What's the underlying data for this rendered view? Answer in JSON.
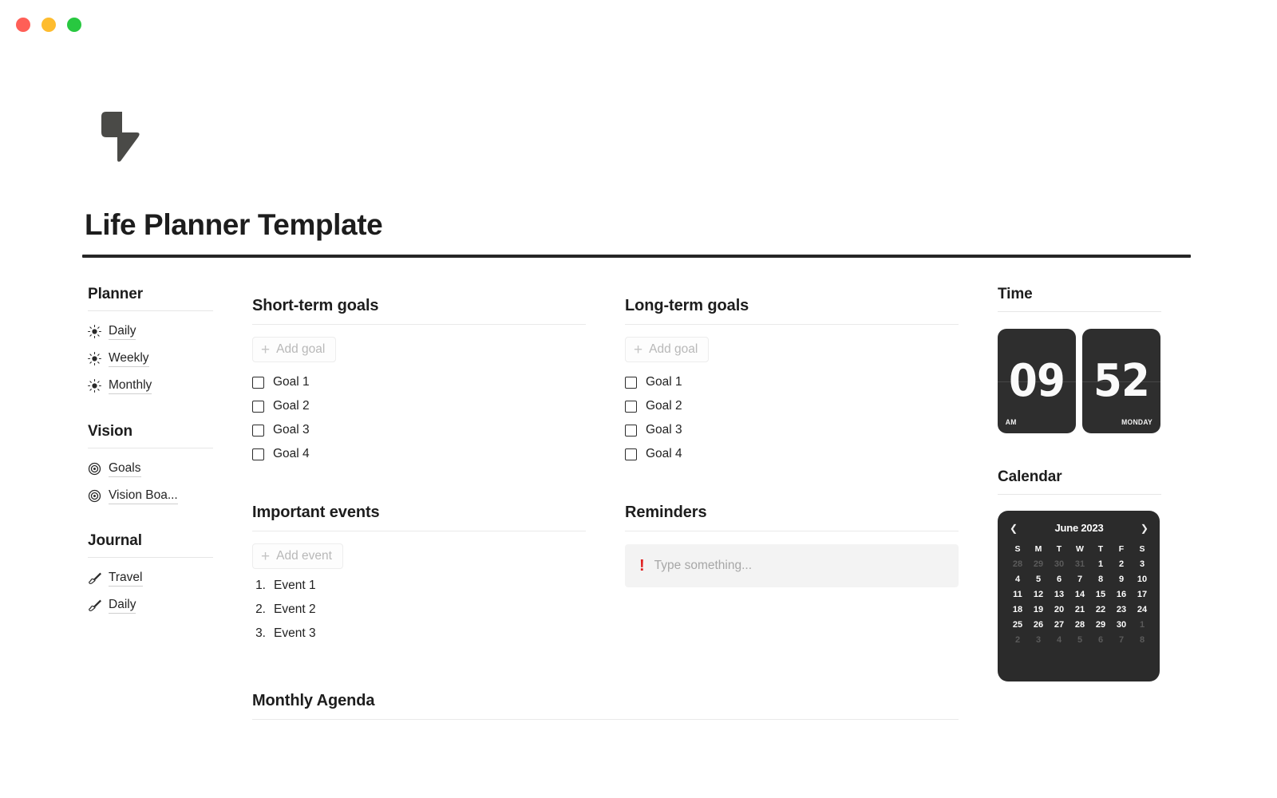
{
  "window": {
    "lights": [
      "close",
      "minimize",
      "maximize"
    ]
  },
  "header": {
    "logo_icon": "lightning-bolt-icon",
    "title": "Life Planner Template"
  },
  "sidebar": {
    "groups": [
      {
        "heading": "Planner",
        "items": [
          {
            "icon": "sun-icon",
            "label": "Daily"
          },
          {
            "icon": "sun-icon",
            "label": "Weekly"
          },
          {
            "icon": "sun-icon",
            "label": "Monthly"
          }
        ]
      },
      {
        "heading": "Vision",
        "items": [
          {
            "icon": "target-icon",
            "label": "Goals"
          },
          {
            "icon": "target-icon",
            "label": "Vision Boa..."
          }
        ]
      },
      {
        "heading": "Journal",
        "items": [
          {
            "icon": "paintbrush-icon",
            "label": "Travel"
          },
          {
            "icon": "paintbrush-icon",
            "label": "Daily"
          }
        ]
      }
    ]
  },
  "short_term_goals": {
    "title": "Short-term goals",
    "add_label": "Add goal",
    "items": [
      "Goal 1",
      "Goal 2",
      "Goal 3",
      "Goal 4"
    ]
  },
  "long_term_goals": {
    "title": "Long-term goals",
    "add_label": "Add goal",
    "items": [
      "Goal 1",
      "Goal 2",
      "Goal 3",
      "Goal 4"
    ]
  },
  "important_events": {
    "title": "Important events",
    "add_label": "Add event",
    "items": [
      "Event 1",
      "Event 2",
      "Event 3"
    ]
  },
  "reminders": {
    "title": "Reminders",
    "icon": "exclamation-icon",
    "icon_color": "#e02020",
    "placeholder": "Type something...",
    "value": ""
  },
  "monthly_agenda": {
    "title": "Monthly Agenda"
  },
  "time_widget": {
    "title": "Time",
    "hours": "09",
    "minutes": "52",
    "meridiem": "AM",
    "weekday": "MONDAY"
  },
  "calendar_widget": {
    "title": "Calendar",
    "prev_icon": "chevron-left-icon",
    "next_icon": "chevron-right-icon",
    "month_label": "June 2023",
    "weekdays": [
      "S",
      "M",
      "T",
      "W",
      "T",
      "F",
      "S"
    ],
    "weeks": [
      [
        {
          "d": "28",
          "muted": true
        },
        {
          "d": "29",
          "muted": true
        },
        {
          "d": "30",
          "muted": true
        },
        {
          "d": "31",
          "muted": true
        },
        {
          "d": "1",
          "muted": false
        },
        {
          "d": "2",
          "muted": false
        },
        {
          "d": "3",
          "muted": false
        }
      ],
      [
        {
          "d": "4",
          "muted": false
        },
        {
          "d": "5",
          "muted": false
        },
        {
          "d": "6",
          "muted": false
        },
        {
          "d": "7",
          "muted": false
        },
        {
          "d": "8",
          "muted": false
        },
        {
          "d": "9",
          "muted": false
        },
        {
          "d": "10",
          "muted": false
        }
      ],
      [
        {
          "d": "11",
          "muted": false
        },
        {
          "d": "12",
          "muted": false
        },
        {
          "d": "13",
          "muted": false
        },
        {
          "d": "14",
          "muted": false
        },
        {
          "d": "15",
          "muted": false
        },
        {
          "d": "16",
          "muted": false
        },
        {
          "d": "17",
          "muted": false
        }
      ],
      [
        {
          "d": "18",
          "muted": false
        },
        {
          "d": "19",
          "muted": false
        },
        {
          "d": "20",
          "muted": false
        },
        {
          "d": "21",
          "muted": false
        },
        {
          "d": "22",
          "muted": false
        },
        {
          "d": "23",
          "muted": false
        },
        {
          "d": "24",
          "muted": false
        }
      ],
      [
        {
          "d": "25",
          "muted": false
        },
        {
          "d": "26",
          "muted": false
        },
        {
          "d": "27",
          "muted": false
        },
        {
          "d": "28",
          "muted": false
        },
        {
          "d": "29",
          "muted": false
        },
        {
          "d": "30",
          "muted": false
        },
        {
          "d": "1",
          "muted": true
        }
      ],
      [
        {
          "d": "2",
          "muted": true
        },
        {
          "d": "3",
          "muted": true
        },
        {
          "d": "4",
          "muted": true
        },
        {
          "d": "5",
          "muted": true
        },
        {
          "d": "6",
          "muted": true
        },
        {
          "d": "7",
          "muted": true
        },
        {
          "d": "8",
          "muted": true
        }
      ]
    ]
  },
  "colors": {
    "accent_dark": "#2b2b2b",
    "rule": "#e6e6e6",
    "title_rule": "#262626",
    "muted_text": "#b8b8b8",
    "alert": "#e02020"
  }
}
